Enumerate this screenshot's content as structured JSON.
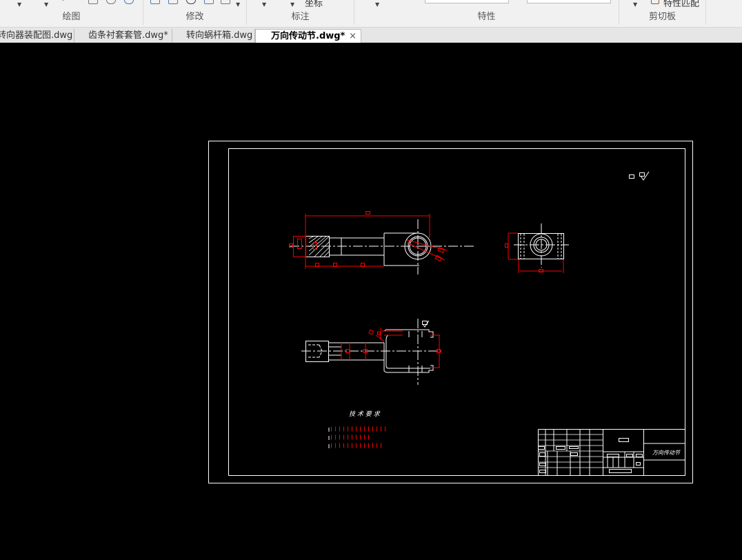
{
  "ribbon": {
    "groups": [
      {
        "label": "绘图"
      },
      {
        "label": "修改"
      },
      {
        "label": "标注"
      },
      {
        "label": "特性"
      },
      {
        "label": "剪切板"
      }
    ],
    "coord_label": "坐标",
    "match_props_label": "特性匹配"
  },
  "tabs": [
    {
      "label": "转向器装配图.dwg"
    },
    {
      "label": "齿条衬套套管.dwg*"
    },
    {
      "label": "转向蜗杆箱.dwg"
    },
    {
      "label": "万向传动节.dwg*",
      "active": true
    }
  ],
  "close_glyph": "×",
  "drawing": {
    "tech_title": "技 术 要 求",
    "part_name": "万向传动节"
  },
  "colors": {
    "line": "#ffffff",
    "dim": "#ff0000",
    "canvas": "#000000"
  }
}
